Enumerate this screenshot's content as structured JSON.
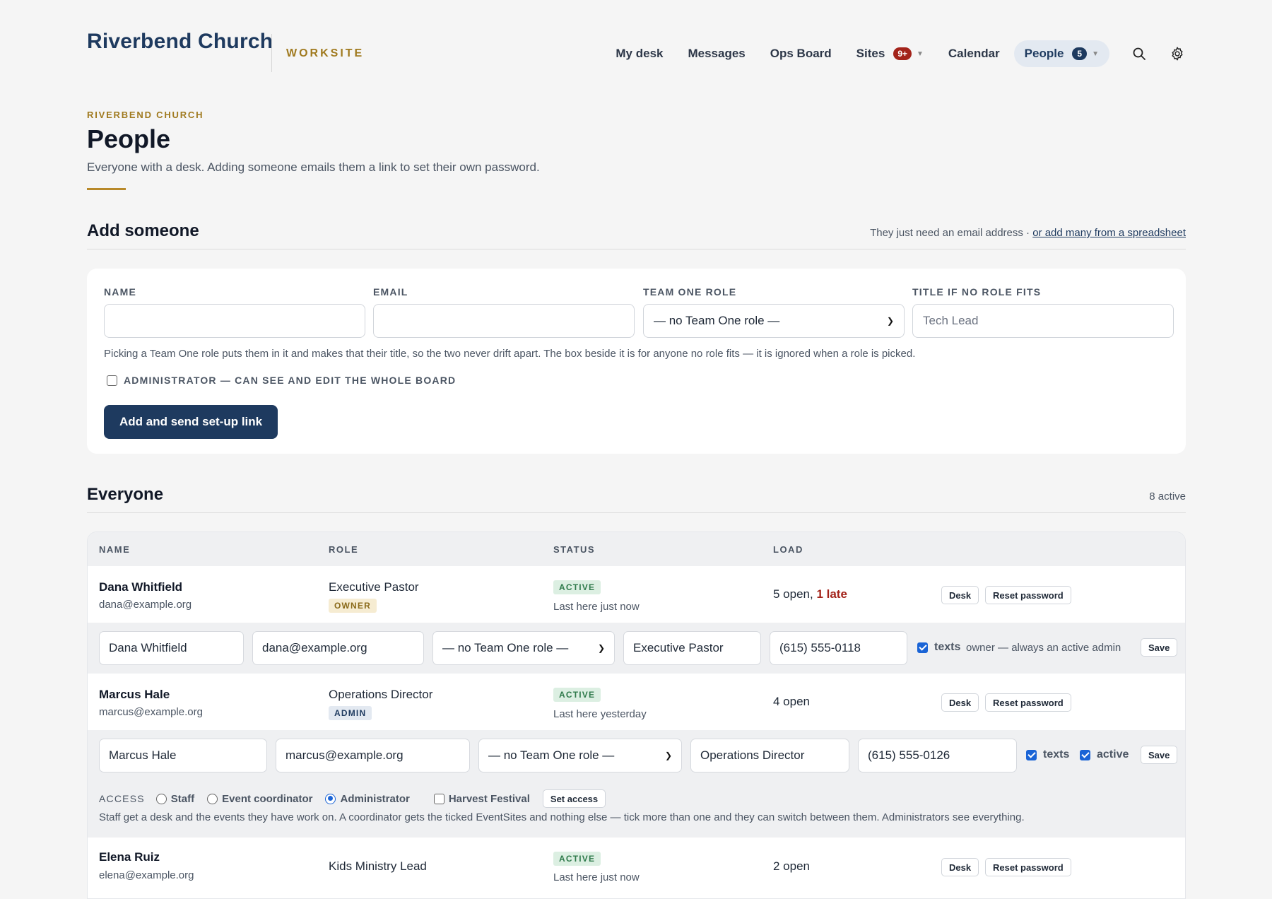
{
  "app": {
    "brand": "Riverbend Church",
    "product": "WORKSITE"
  },
  "nav": {
    "items": [
      {
        "label": "My desk"
      },
      {
        "label": "Messages"
      },
      {
        "label": "Ops Board"
      },
      {
        "label": "Sites",
        "badge": "9+"
      },
      {
        "label": "Calendar"
      },
      {
        "label": "People",
        "badge": "5",
        "active": true
      }
    ],
    "icons": [
      "search-icon",
      "gear-icon"
    ]
  },
  "header": {
    "eyebrow": "RIVERBEND CHURCH",
    "title": "People",
    "subtitle": "Everyone with a desk. Adding someone emails them a link to set their own password."
  },
  "add": {
    "heading": "Add someone",
    "aside": "They just need an email address · ",
    "aside_link": "or add many from a spreadsheet",
    "labels": {
      "name": "NAME",
      "email": "EMAIL",
      "role": "TEAM ONE ROLE",
      "title": "TITLE IF NO ROLE FITS"
    },
    "values": {
      "name": "",
      "email": "",
      "role": "— no Team One role —",
      "title_placeholder": "Tech Lead"
    },
    "hint": "Picking a Team One role puts them in it and makes that their title, so the two never drift apart. The box beside it is for anyone no role fits — it is ignored when a role is picked.",
    "admin_checkbox": "ADMINISTRATOR — CAN SEE AND EDIT THE WHOLE BOARD",
    "submit": "Add and send set-up link"
  },
  "everyone": {
    "heading": "Everyone",
    "count": "8 active",
    "columns": [
      "NAME",
      "ROLE",
      "STATUS",
      "LOAD"
    ],
    "buttons": {
      "desk": "Desk",
      "reset": "Reset password",
      "save": "Save",
      "set_access": "Set access"
    },
    "rows": [
      {
        "name": "Dana Whitfield",
        "email": "dana@example.org",
        "role": "Executive Pastor",
        "tag": "OWNER",
        "status": "ACTIVE",
        "last_here": "Last here just now",
        "load": "5 open, ",
        "late": "1 late",
        "edit": {
          "name": "Dana Whitfield",
          "email": "dana@example.org",
          "team_role": "— no Team One role —",
          "title": "Executive Pastor",
          "phone": "(615) 555-0118",
          "texts": "texts",
          "note": "owner — always an active admin"
        }
      },
      {
        "name": "Marcus Hale",
        "email": "marcus@example.org",
        "role": "Operations Director",
        "tag": "ADMIN",
        "status": "ACTIVE",
        "last_here": "Last here yesterday",
        "load": "4 open",
        "edit": {
          "name": "Marcus Hale",
          "email": "marcus@example.org",
          "team_role": "— no Team One role —",
          "title": "Operations Director",
          "phone": "(615) 555-0126",
          "texts": "texts",
          "active": "active"
        },
        "access": {
          "label": "ACCESS",
          "options": [
            "Staff",
            "Event coordinator",
            "Administrator"
          ],
          "selected": "Administrator",
          "site": "Harvest Festival",
          "note": "Staff get a desk and the events they have work on. A coordinator gets the ticked EventSites and nothing else — tick more than one and they can switch between them. Administrators see everything."
        }
      },
      {
        "name": "Elena Ruiz",
        "email": "elena@example.org",
        "role": "Kids Ministry Lead",
        "status": "ACTIVE",
        "last_here": "Last here just now",
        "load": "2 open"
      }
    ]
  }
}
